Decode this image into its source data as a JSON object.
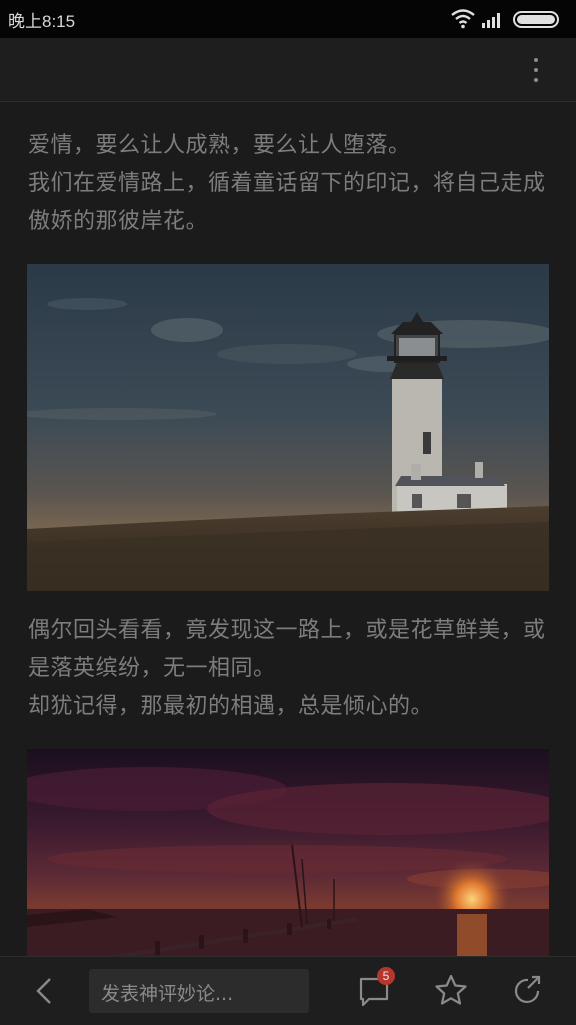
{
  "status_bar": {
    "time": "晚上8:15",
    "icons": [
      "wifi-icon",
      "signal-icon",
      "battery-icon"
    ]
  },
  "app_bar": {
    "more_icon": "more-vertical-icon"
  },
  "article": {
    "paragraph_1": {
      "line_1": "爱情，要么让人成熟，要么让人堕落。",
      "line_2": "我们在爱情路上，循着童话留下的印记，将自己走成傲娇的那彼岸花。"
    },
    "image_1": "lighthouse-photo",
    "paragraph_2": {
      "line_1": "偶尔回头看看，竟发现这一路上，或是花草鲜美，或是落英缤纷，无一相同。",
      "line_2": "却犹记得，那最初的相遇，总是倾心的。"
    },
    "image_2": "sunset-pier-photo"
  },
  "bottom_bar": {
    "back_icon": "back-icon",
    "comment_placeholder": "发表神评妙论...",
    "comment_count": "5",
    "comment_icon": "comment-icon",
    "favorite_icon": "star-icon",
    "share_icon": "share-icon"
  },
  "colors": {
    "background": "#1b1b1b",
    "text": "#7d7d7d",
    "badge": "#b5362d"
  }
}
